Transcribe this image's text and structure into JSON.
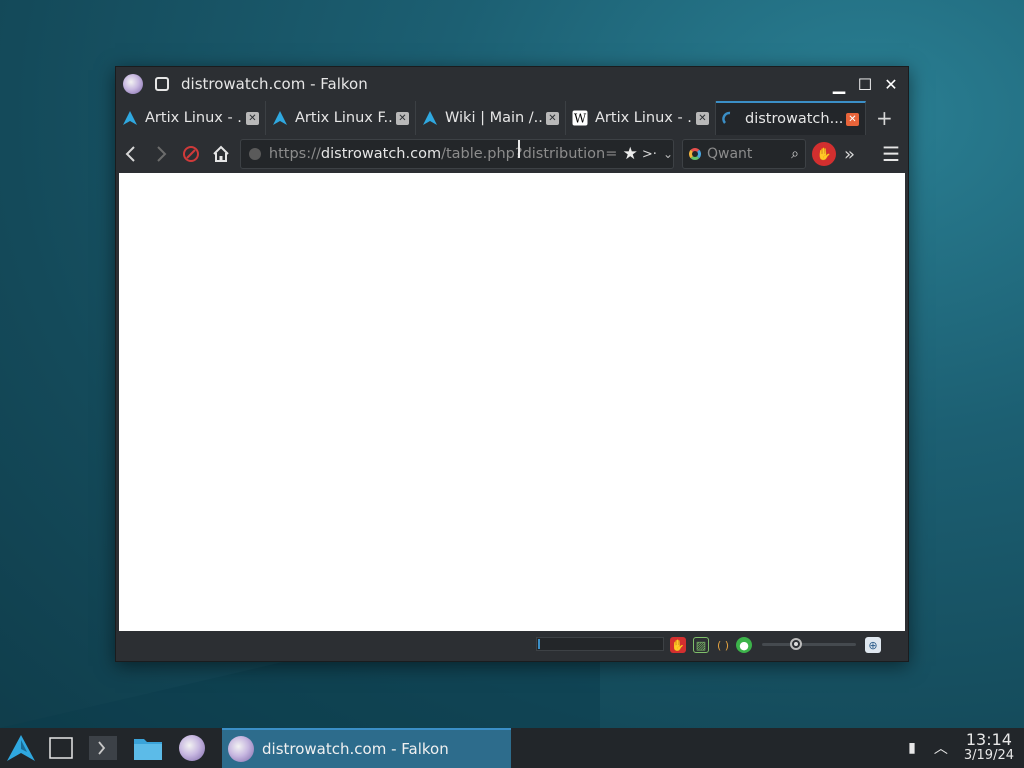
{
  "window": {
    "title": "distrowatch.com - Falkon",
    "controls": {
      "minimize": "▁",
      "maximize": "☐",
      "close": "✕"
    }
  },
  "tabs": [
    {
      "label": "Artix Linux - ...",
      "favicon": "artix-icon",
      "active": false
    },
    {
      "label": "Artix Linux F...",
      "favicon": "artix-icon",
      "active": false
    },
    {
      "label": "Wiki | Main /...",
      "favicon": "artix-icon",
      "active": false
    },
    {
      "label": "Artix Linux - ...",
      "favicon": "wikipedia-icon",
      "active": false
    },
    {
      "label": "distrowatch....",
      "favicon": "loading-spinner-icon",
      "active": true
    }
  ],
  "newtab": "+",
  "url": {
    "scheme": "https://",
    "domain": "distrowatch.com",
    "path": "/table.php?distribution=artix"
  },
  "search": {
    "placeholder": "Qwant"
  },
  "taskbar": {
    "task_label": "distrowatch.com - Falkon",
    "time": "13:14",
    "date": "3/19/24"
  },
  "statusbar": {
    "load_progress": 0.02
  },
  "colors": {
    "accent": "#3b8fc7",
    "taskbar_active": "#2d6c8c",
    "close_active": "#e8643a"
  }
}
